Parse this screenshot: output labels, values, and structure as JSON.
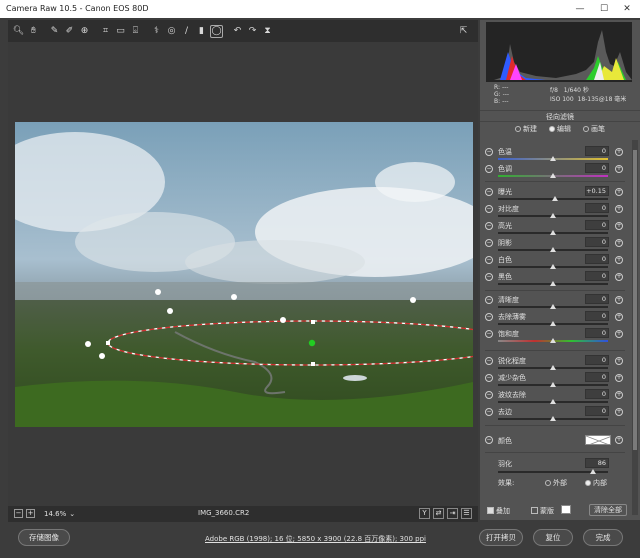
{
  "window": {
    "title": "Camera Raw 10.5 -  Canon EOS 80D",
    "min": "—",
    "max": "☐",
    "close": "✕"
  },
  "toolbar": {
    "tools": [
      "search-icon",
      "hand-icon",
      "white-balance-icon",
      "color-sampler-icon",
      "target-adjust-icon",
      "crop-icon",
      "straighten-icon",
      "transform-icon",
      "spot-removal-icon",
      "red-eye-icon",
      "brush-icon",
      "graduated-filter-icon",
      "radial-filter-icon",
      "rotate-ccw-icon",
      "rotate-cw-icon",
      "flip-icon"
    ],
    "open_prefs": "⇱"
  },
  "meta": {
    "r_label": "R:",
    "g_label": "G:",
    "b_label": "B:",
    "dash": "---",
    "aperture": "f/8",
    "shutter": "1/640 秒",
    "iso": "ISO 100",
    "lens": "18-135@18 毫米"
  },
  "panel": {
    "title": "径向滤镜",
    "modes": [
      "新建",
      "编辑",
      "画笔"
    ],
    "selected_mode": 1,
    "sliders": [
      {
        "label": "色温",
        "value": "0",
        "pos": 0.5
      },
      {
        "label": "色调",
        "value": "0",
        "pos": 0.5
      },
      {
        "label": "曝光",
        "value": "+0.15",
        "pos": 0.52
      },
      {
        "label": "对比度",
        "value": "0",
        "pos": 0.5
      },
      {
        "label": "高光",
        "value": "0",
        "pos": 0.5
      },
      {
        "label": "阴影",
        "value": "0",
        "pos": 0.5
      },
      {
        "label": "白色",
        "value": "0",
        "pos": 0.5
      },
      {
        "label": "黑色",
        "value": "0",
        "pos": 0.5
      },
      {
        "label": "清晰度",
        "value": "0",
        "pos": 0.5
      },
      {
        "label": "去除薄雾",
        "value": "0",
        "pos": 0.5
      },
      {
        "label": "饱和度",
        "value": "0",
        "pos": 0.5
      },
      {
        "label": "锐化程度",
        "value": "0",
        "pos": 0.5
      },
      {
        "label": "减少杂色",
        "value": "0",
        "pos": 0.5
      },
      {
        "label": "波纹去除",
        "value": "0",
        "pos": 0.5
      },
      {
        "label": "去边",
        "value": "0",
        "pos": 0.5
      }
    ],
    "color_label": "颜色",
    "feather_label": "羽化",
    "feather_value": "86",
    "feather_pos": 0.86,
    "effect_label": "效果:",
    "effect_options": [
      "外部",
      "内部"
    ],
    "effect_selected": 1,
    "overlay_label": "叠加",
    "mask_label": "蒙版",
    "clear_all": "清除全部"
  },
  "status": {
    "zoom": "14.6%",
    "filename": "IMG_3660.CR2",
    "zoom_minus": "−",
    "zoom_plus": "+"
  },
  "footer": {
    "save_image": "存储图像",
    "workflow_link": "Adobe RGB (1998); 16 位; 5850 x 3900 (22.8 百万像素); 300 ppi",
    "open_copy": "打开拷贝",
    "reset": "复位",
    "done": "完成"
  },
  "colors": {
    "accent": "#e0e0e0",
    "mask_ring": "#ffffff",
    "center_pin": "#22cc22"
  }
}
